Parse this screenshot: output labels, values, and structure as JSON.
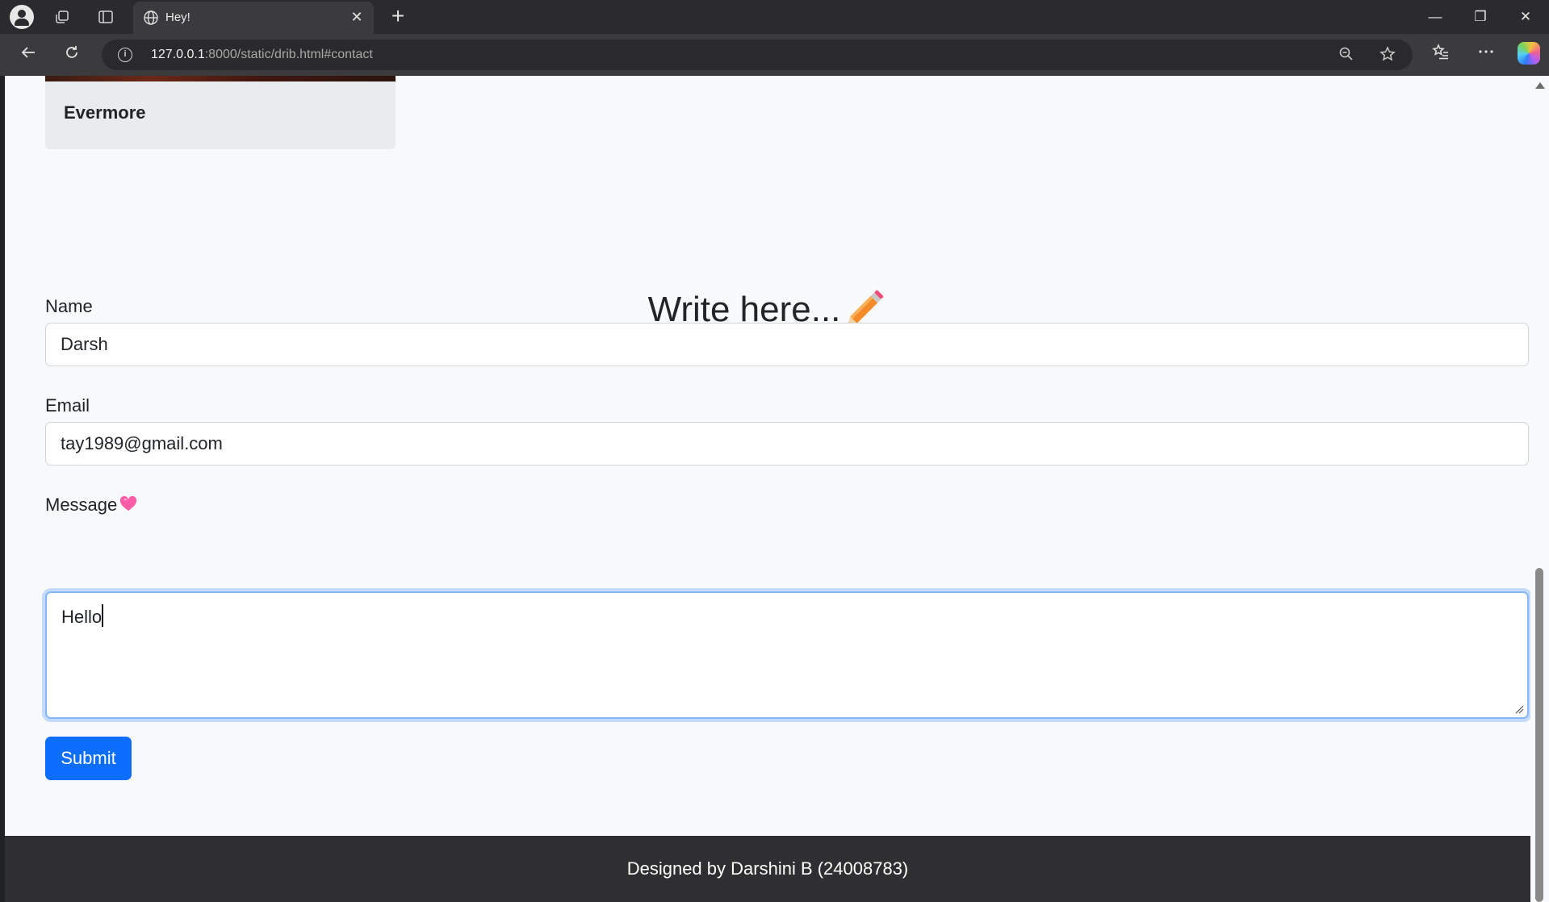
{
  "browser": {
    "tab_title": "Hey!",
    "tab_close": "✕",
    "new_tab": "+",
    "url_host": "127.0.0.1",
    "url_rest": ":8000/static/drib.html#contact",
    "window_controls": {
      "minimize": "—",
      "restore": "❐",
      "close": "✕"
    }
  },
  "page": {
    "album_title": "Evermore",
    "heading": "Write here...",
    "form": {
      "name_label": "Name",
      "name_value": "Darsh",
      "email_label": "Email",
      "email_value": "tay1989@gmail.com",
      "message_label": "Message",
      "message_value": "Hello",
      "submit_label": "Submit"
    },
    "footer_text": "Designed by Darshini B (24008783)"
  },
  "colors": {
    "accent": "#0d6efd",
    "focus_ring": "#86b7fe",
    "footer_bg": "#2f2f31",
    "page_bg": "#f8f9fa",
    "card_bg": "#e9ecef"
  }
}
